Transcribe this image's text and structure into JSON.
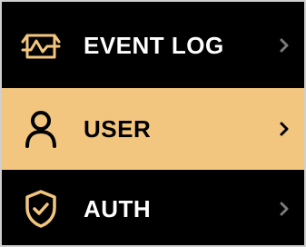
{
  "colors": {
    "background": "#000000",
    "text": "#ffffff",
    "icon_accent": "#f2c67f",
    "selected_bg": "#f2c67f",
    "selected_fg": "#000000",
    "chevron_inactive": "#7a7a7a"
  },
  "menu": {
    "items": [
      {
        "label": "EVENT LOG",
        "icon": "activity-chart-icon",
        "selected": false
      },
      {
        "label": "USER",
        "icon": "user-icon",
        "selected": true
      },
      {
        "label": "AUTH",
        "icon": "shield-check-icon",
        "selected": false
      }
    ]
  }
}
